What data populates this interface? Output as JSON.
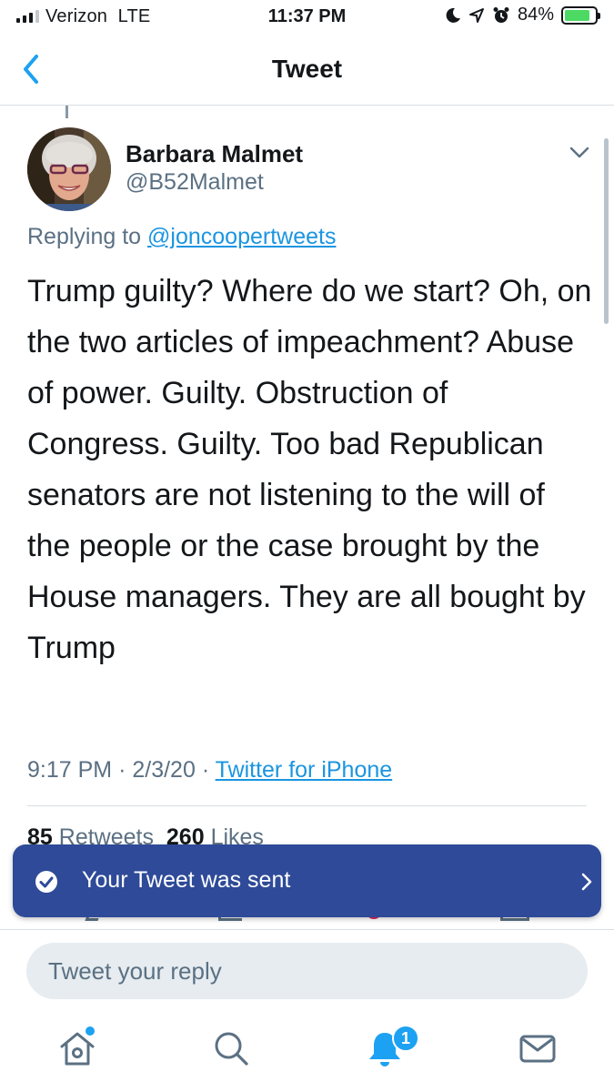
{
  "status_bar": {
    "carrier": "Verizon",
    "network": "LTE",
    "time": "11:37 PM",
    "battery_percent": "84%",
    "battery_level": 0.84,
    "icons": [
      "signal-icon",
      "do-not-disturb-moon-icon",
      "location-arrow-icon",
      "alarm-icon",
      "battery-charging-icon"
    ]
  },
  "nav": {
    "title": "Tweet",
    "back_icon": "chevron-left-icon"
  },
  "tweet": {
    "display_name": "Barbara Malmet",
    "handle": "@B52Malmet",
    "replying_to_prefix": "Replying to",
    "replying_to_handle": "@joncoopertweets",
    "text": "Trump guilty? Where do we start? Oh, on the two articles of impeachment? Abuse of power. Guilty. Obstruction of Congress. Guilty. Too bad Republican senators are not listening to the will of the people or the case brought by the House managers. They are all bought by Trump",
    "time": "9:17 PM",
    "date": "2/3/20",
    "separator": "·",
    "source": "Twitter for iPhone",
    "retweets_count": "85",
    "retweets_label": "Retweets",
    "likes_count": "260",
    "likes_label": "Likes"
  },
  "toast": {
    "message": "Your Tweet was sent",
    "icon": "check-circle-icon"
  },
  "composer": {
    "placeholder": "Tweet your reply"
  },
  "tabbar": {
    "items": [
      "home-icon",
      "search-icon",
      "notifications-bell-icon",
      "messages-envelope-icon"
    ],
    "notification_count": "1"
  },
  "colors": {
    "accent": "#1da1f2",
    "link": "#1b95e0",
    "toast_bg": "#2e4a98",
    "secondary_text": "#5b7083"
  }
}
